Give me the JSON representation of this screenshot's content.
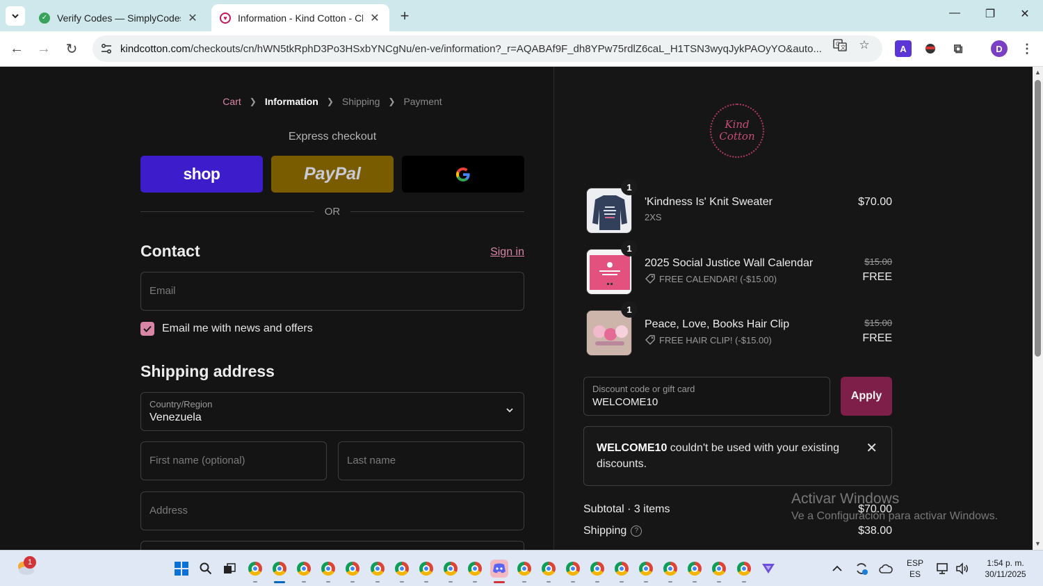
{
  "browser": {
    "tabs": [
      {
        "title": "Verify Codes — SimplyCodes",
        "active": false
      },
      {
        "title": "Information - Kind Cotton - Checkout",
        "active": true
      }
    ],
    "url_host": "kindcotton.com",
    "url_path": "/checkouts/cn/hWN5tkRphD3Po3HSxbYNCgNu/en-ve/information?_r=AQABAf9F_dh8YPw75rdlZ6caL_H1TSN3wyqJykPAOyYO&auto...",
    "profile_initial": "D"
  },
  "breadcrumb": [
    "Cart",
    "Information",
    "Shipping",
    "Payment"
  ],
  "express": {
    "title": "Express checkout",
    "shop_label": "shop",
    "paypal_label": "PayPal",
    "or_label": "OR"
  },
  "contact": {
    "title": "Contact",
    "signin": "Sign in",
    "email_placeholder": "Email",
    "newsletter_label": "Email me with news and offers",
    "newsletter_checked": true
  },
  "shipping": {
    "title": "Shipping address",
    "country_label": "Country/Region",
    "country_value": "Venezuela",
    "first_name_placeholder": "First name (optional)",
    "last_name_placeholder": "Last name",
    "address_placeholder": "Address"
  },
  "order": {
    "logo_line1": "Kind",
    "logo_line2": "Cotton",
    "items": [
      {
        "qty": "1",
        "name": "'Kindness Is' Knit Sweater",
        "variant": "2XS",
        "price": "$70.00"
      },
      {
        "qty": "1",
        "name": "2025 Social Justice Wall Calendar",
        "discount": "FREE CALENDAR! (-$15.00)",
        "original_price": "$15.00",
        "price": "FREE"
      },
      {
        "qty": "1",
        "name": "Peace, Love, Books Hair Clip",
        "discount": "FREE HAIR CLIP! (-$15.00)",
        "original_price": "$15.00",
        "price": "FREE"
      }
    ],
    "discount_label": "Discount code or gift card",
    "discount_value": "WELCOME10",
    "apply_label": "Apply",
    "alert_code": "WELCOME10",
    "alert_text": " couldn't be used with your existing discounts.",
    "subtotal_label": "Subtotal · 3 items",
    "subtotal_value": "$70.00",
    "shipping_label": "Shipping",
    "shipping_value": "$38.00"
  },
  "watermark": {
    "line1": "Activar Windows",
    "line2": "Ve a Configuración para activar Windows."
  },
  "taskbar": {
    "notification_count": "1",
    "lang_line1": "ESP",
    "lang_line2": "ES",
    "time": "1:54 p. m.",
    "date": "30/11/2025"
  },
  "colors": {
    "accent_pink": "#d985a6",
    "apply_bg": "#7d1f48",
    "shop_bg": "#3d1ccc",
    "paypal_bg": "#7a5c00"
  }
}
